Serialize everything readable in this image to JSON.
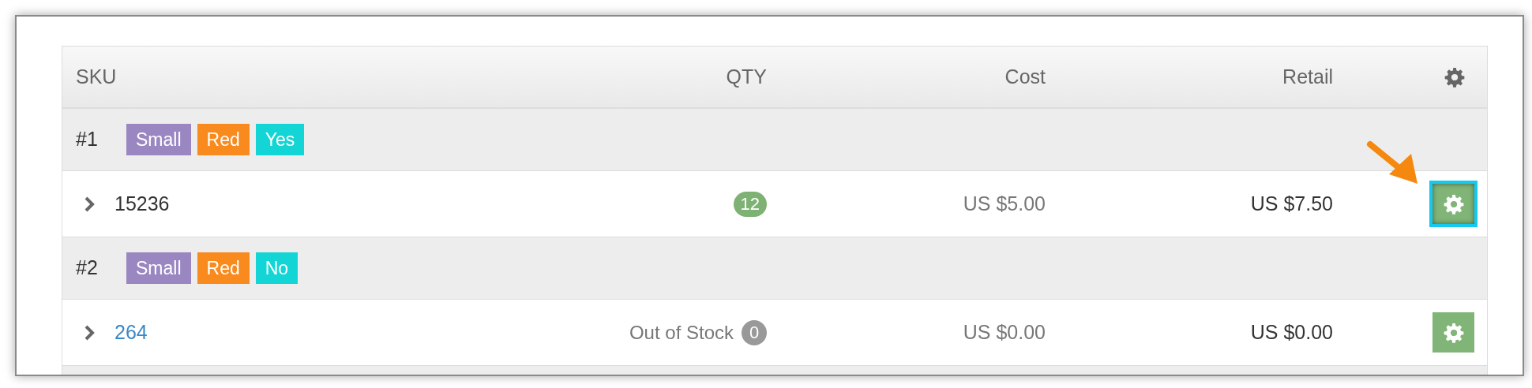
{
  "table": {
    "columns": [
      {
        "label": "SKU",
        "kind": "text"
      },
      {
        "label": "QTY",
        "kind": "text"
      },
      {
        "label": "Cost",
        "kind": "text"
      },
      {
        "label": "Retail",
        "kind": "text"
      },
      {
        "kind": "gear"
      }
    ],
    "rows": [
      {
        "kind": "group",
        "number": "#1",
        "tags": [
          {
            "label": "Small",
            "color": "#9a87c2"
          },
          {
            "label": "Red",
            "color": "#f98a1d"
          },
          {
            "label": "Yes",
            "color": "#14d5d5"
          }
        ]
      },
      {
        "kind": "item",
        "expanded": false,
        "sku": "15236",
        "sku_link": false,
        "qty": "12",
        "in_stock": true,
        "cost": "US $5.00",
        "retail": "US $7.50",
        "highlighted": true
      },
      {
        "kind": "group",
        "number": "#2",
        "tags": [
          {
            "label": "Small",
            "color": "#9a87c2"
          },
          {
            "label": "Red",
            "color": "#f98a1d"
          },
          {
            "label": "No",
            "color": "#14d5d5"
          }
        ]
      },
      {
        "kind": "item",
        "expanded": false,
        "sku": "264",
        "sku_link": true,
        "stock_label": "Out of Stock",
        "qty": "0",
        "in_stock": false,
        "cost": "US $0.00",
        "retail": "US $0.00",
        "highlighted": false
      },
      {
        "kind": "group"
      }
    ]
  }
}
